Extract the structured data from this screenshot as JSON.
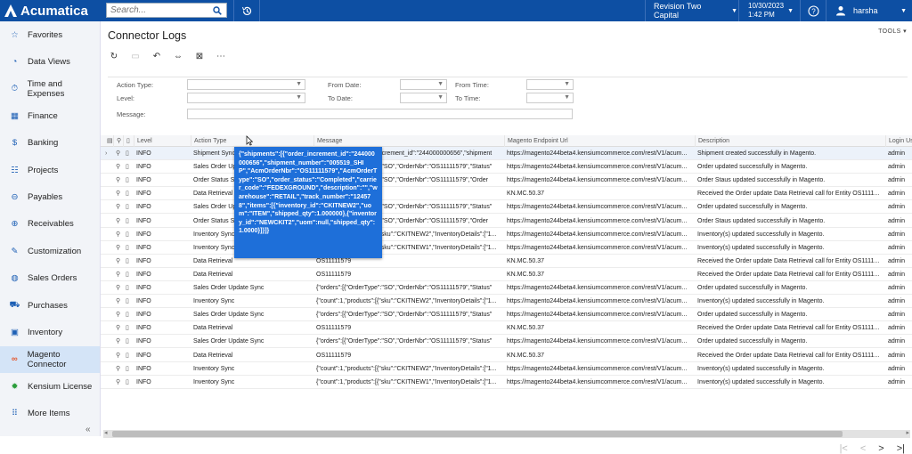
{
  "app": {
    "logo": "Acumatica",
    "search_placeholder": "Search..."
  },
  "topbar": {
    "tenant": "Revision Two Capital",
    "date": "10/30/2023",
    "time": "1:42 PM",
    "user": "harsha"
  },
  "sidebar": {
    "items": [
      {
        "label": "Favorites",
        "icon": "star-icon"
      },
      {
        "label": "Data Views",
        "icon": "pie-chart-icon"
      },
      {
        "label": "Time and Expenses",
        "icon": "stopwatch-icon"
      },
      {
        "label": "Finance",
        "icon": "calculator-icon"
      },
      {
        "label": "Banking",
        "icon": "dollar-icon"
      },
      {
        "label": "Projects",
        "icon": "projects-icon"
      },
      {
        "label": "Payables",
        "icon": "minus-circle-icon"
      },
      {
        "label": "Receivables",
        "icon": "plus-circle-icon"
      },
      {
        "label": "Customization",
        "icon": "wrench-icon"
      },
      {
        "label": "Sales Orders",
        "icon": "globe-icon"
      },
      {
        "label": "Purchases",
        "icon": "cart-icon"
      },
      {
        "label": "Inventory",
        "icon": "box-icon"
      },
      {
        "label": "Magento Connector",
        "icon": "magento-icon"
      },
      {
        "label": "Kensium License",
        "icon": "gear-icon"
      },
      {
        "label": "More Items",
        "icon": "grid-icon"
      }
    ]
  },
  "page": {
    "title": "Connector Logs",
    "tools": "TOOLS"
  },
  "filters": {
    "action_type": "Action Type:",
    "level": "Level:",
    "message": "Message:",
    "from_date": "From Date:",
    "to_date": "To Date:",
    "from_time": "From Time:",
    "to_time": "To Time:"
  },
  "grid": {
    "columns": [
      "Level",
      "Action Type",
      "Message",
      "Magento Endpoint Url",
      "Description",
      "Login Us"
    ],
    "rows": [
      [
        "INFO",
        "Shipment Sync",
        "{\"shipments\":[{\"order_increment_id\":\"244000000656\",\"shipment",
        "https://magento244beta4.kensiumcommerce.com/rest/V1/acum...",
        "Shipment created successfully in Magento.",
        "admin"
      ],
      [
        "INFO",
        "Sales Order Update Sync",
        "{\"orders\":[{\"OrderType\":\"SO\",\"OrderNbr\":\"OS11111579\",\"Status\"",
        "https://magento244beta4.kensiumcommerce.com/rest/V1/acum...",
        "Order updated successfully in Magento.",
        "admin"
      ],
      [
        "INFO",
        "Order Status Sync",
        "{\"orders\":[{\"OrderType\":\"SO\",\"OrderNbr\":\"OS11111579\",\"Order",
        "https://magento244beta4.kensiumcommerce.com/rest/V1/acum...",
        "Order Staus updated successfully in Magento.",
        "admin"
      ],
      [
        "INFO",
        "Data Retrieval",
        "OS11111579",
        "KN.MC.50.37",
        "Received the Order update Data Retrieval call for Entity OS1111...",
        "admin"
      ],
      [
        "INFO",
        "Sales Order Update Sync",
        "{\"orders\":[{\"OrderType\":\"SO\",\"OrderNbr\":\"OS11111579\",\"Status\"",
        "https://magento244beta4.kensiumcommerce.com/rest/V1/acum...",
        "Order updated successfully in Magento.",
        "admin"
      ],
      [
        "INFO",
        "Order Status Sync",
        "{\"orders\":[{\"OrderType\":\"SO\",\"OrderNbr\":\"OS11111579\",\"Order",
        "https://magento244beta4.kensiumcommerce.com/rest/V1/acum...",
        "Order Staus updated successfully in Magento.",
        "admin"
      ],
      [
        "INFO",
        "Inventory Sync",
        "{\"count\":1,\"products\":[{\"sku\":\"CKITNEW2\",\"InventoryDetails\":[\"1...",
        "https://magento244beta4.kensiumcommerce.com/rest/V1/acum...",
        "Inventory(s) updated successfully in Magento.",
        "admin"
      ],
      [
        "INFO",
        "Inventory Sync",
        "{\"count\":1,\"products\":[{\"sku\":\"CKITNEW1\",\"InventoryDetails\":[\"1...",
        "https://magento244beta4.kensiumcommerce.com/rest/V1/acum...",
        "Inventory(s) updated successfully in Magento.",
        "admin"
      ],
      [
        "INFO",
        "Data Retrieval",
        "OS11111579",
        "KN.MC.50.37",
        "Received the Order update Data Retrieval call for Entity OS1111...",
        "admin"
      ],
      [
        "INFO",
        "Data Retrieval",
        "OS11111579",
        "KN.MC.50.37",
        "Received the Order update Data Retrieval call for Entity OS1111...",
        "admin"
      ],
      [
        "INFO",
        "Sales Order Update Sync",
        "{\"orders\":[{\"OrderType\":\"SO\",\"OrderNbr\":\"OS11111579\",\"Status\"",
        "https://magento244beta4.kensiumcommerce.com/rest/V1/acum...",
        "Order updated successfully in Magento.",
        "admin"
      ],
      [
        "INFO",
        "Inventory Sync",
        "{\"count\":1,\"products\":[{\"sku\":\"CKITNEW2\",\"InventoryDetails\":[\"1...",
        "https://magento244beta4.kensiumcommerce.com/rest/V1/acum...",
        "Inventory(s) updated successfully in Magento.",
        "admin"
      ],
      [
        "INFO",
        "Sales Order Update Sync",
        "{\"orders\":[{\"OrderType\":\"SO\",\"OrderNbr\":\"OS11111579\",\"Status\"",
        "https://magento244beta4.kensiumcommerce.com/rest/V1/acum...",
        "Order updated successfully in Magento.",
        "admin"
      ],
      [
        "INFO",
        "Data Retrieval",
        "OS11111579",
        "KN.MC.50.37",
        "Received the Order update Data Retrieval call for Entity OS1111...",
        "admin"
      ],
      [
        "INFO",
        "Sales Order Update Sync",
        "{\"orders\":[{\"OrderType\":\"SO\",\"OrderNbr\":\"OS11111579\",\"Status\"",
        "https://magento244beta4.kensiumcommerce.com/rest/V1/acum...",
        "Order updated successfully in Magento.",
        "admin"
      ],
      [
        "INFO",
        "Data Retrieval",
        "OS11111579",
        "KN.MC.50.37",
        "Received the Order update Data Retrieval call for Entity OS1111...",
        "admin"
      ],
      [
        "INFO",
        "Inventory Sync",
        "{\"count\":1,\"products\":[{\"sku\":\"CKITNEW2\",\"InventoryDetails\":[\"1...",
        "https://magento244beta4.kensiumcommerce.com/rest/V1/acum...",
        "Inventory(s) updated successfully in Magento.",
        "admin"
      ],
      [
        "INFO",
        "Inventory Sync",
        "{\"count\":1,\"products\":[{\"sku\":\"CKITNEW1\",\"InventoryDetails\":[\"1...",
        "https://magento244beta4.kensiumcommerce.com/rest/V1/acum...",
        "Inventory(s) updated successfully in Magento.",
        "admin"
      ]
    ]
  },
  "tooltip": "{\"shipments\":[{\"order_increment_id\":\"244000000656\",\"shipment_number\":\"005519_SHIP\",\"AcmOrderNbr\":\"OS11111579\",\"AcmOrderType\":\"SO\",\"order_status\":\"Completed\",\"carrier_code\":\"FEDEXGROUND\",\"description\":\"\",\"warehouse\":\"RETAIL\",\"track_number\":\"124578\",\"items\":[{\"inventory_id\":\"CKITNEW2\",\"uom\":\"ITEM\",\"shipped_qty\":1.000000},{\"inventory_id\":\"NEWCKIT2\",\"uom\":null,\"shipped_qty\":1.0000}]}]}",
  "colors": {
    "brand": "#0d4fa3",
    "tooltip": "#1e6fd9",
    "active_nav": "#d4e4f7"
  }
}
